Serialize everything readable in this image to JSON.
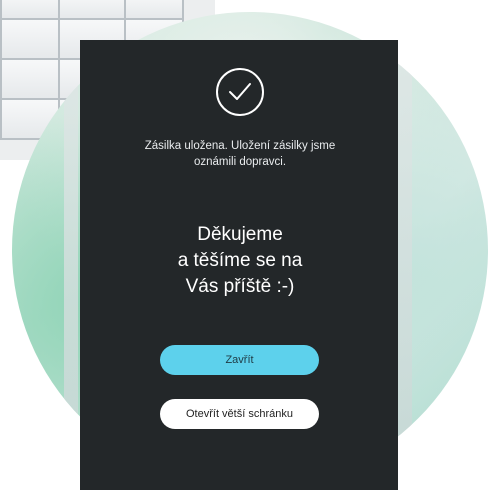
{
  "confirmation": {
    "message_line1": "Zásilka uložena. Uložení zásilky jsme",
    "message_line2": "oznámili dopravci.",
    "thanks_line1": "Děkujeme",
    "thanks_line2": "a těšíme se na",
    "thanks_line3": "Vás příště :-)"
  },
  "buttons": {
    "close_label": "Zavřít",
    "bigger_box_label": "Otevřít větší schránku"
  },
  "colors": {
    "screen_bg": "#232729",
    "accent": "#5dd1ec",
    "secondary_button": "#ffffff"
  },
  "icons": {
    "success": "check-circle-icon"
  }
}
